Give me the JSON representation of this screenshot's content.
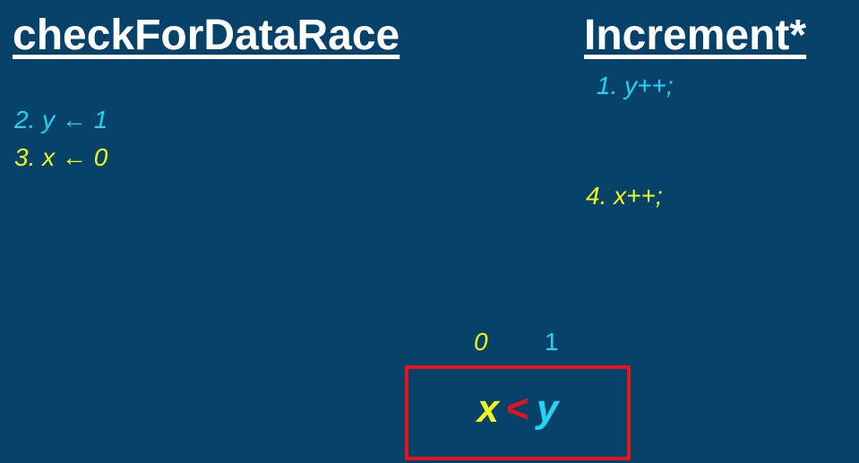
{
  "left_panel": {
    "title": "checkForDataRace",
    "steps": [
      {
        "text": "2. y  ← 1",
        "color": "#22d5f2"
      },
      {
        "text": "3. x ← 0",
        "color": "#eff51d"
      }
    ]
  },
  "right_panel": {
    "title": "Increment*",
    "steps": [
      {
        "text": "1. y++;",
        "color": "#22d5f2"
      },
      {
        "text": "4. x++;",
        "color": "#eff51d"
      }
    ]
  },
  "values": {
    "x": "0",
    "y": "1"
  },
  "condition": {
    "left": "x",
    "operator": "<",
    "right": "y",
    "border_color": "#e3151b"
  },
  "colors": {
    "background": "#06426a",
    "title": "#ffffff",
    "cyan": "#22d5f2",
    "yellow": "#eff51d",
    "red": "#e3151b"
  }
}
